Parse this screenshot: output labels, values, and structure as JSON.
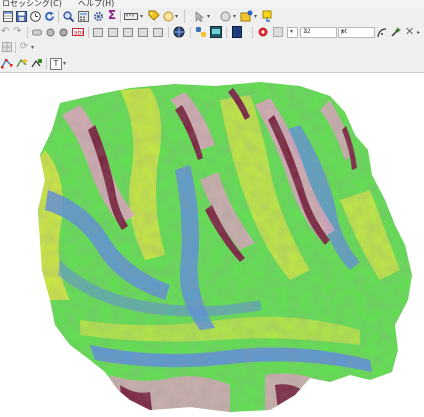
{
  "menubar": {
    "items": [
      "ロセッシング(C)",
      "ヘルプ(H)"
    ]
  },
  "toolbar1": {
    "icons": [
      "table-icon",
      "save-edits-icon",
      "clock-icon",
      "refresh-icon",
      "zoom-identify-icon",
      "calculator-icon",
      "gear-icon",
      "sigma-icon",
      "measure-icon",
      "tag-icon",
      "select-icon",
      "pointer-icon",
      "label-icon",
      "annotation-icon"
    ],
    "sigma_glyph": "Σ"
  },
  "toolbar2": {
    "font_size_value": "12",
    "unit_value": "pt",
    "icons": [
      "undo-icon",
      "redo-icon",
      "pin-icon",
      "add-icon",
      "delete-icon",
      "text-icon",
      "move-label-icon",
      "rotate-label-icon",
      "python-icon",
      "database-icon",
      "book-icon",
      "record-icon",
      "curve-icon",
      "magic-wand-icon",
      "close-icon"
    ]
  },
  "toolbar3": {
    "icons": [
      "grid-icon",
      "circle-arrow-icon"
    ]
  },
  "toolbar4": {
    "icons": [
      "node-tool-icon",
      "add-feature-icon",
      "text-annotation-icon"
    ],
    "text_glyph": "T"
  },
  "colors": {
    "toolbar_bg": "#efefef",
    "map_bg": "#ffffff",
    "terrain_green": "#5fe34e",
    "terrain_yellow": "#e8ec3c",
    "terrain_blue": "#5a8fe0",
    "terrain_pink": "#e6a3c6",
    "terrain_maroon": "#7a1f3c"
  }
}
